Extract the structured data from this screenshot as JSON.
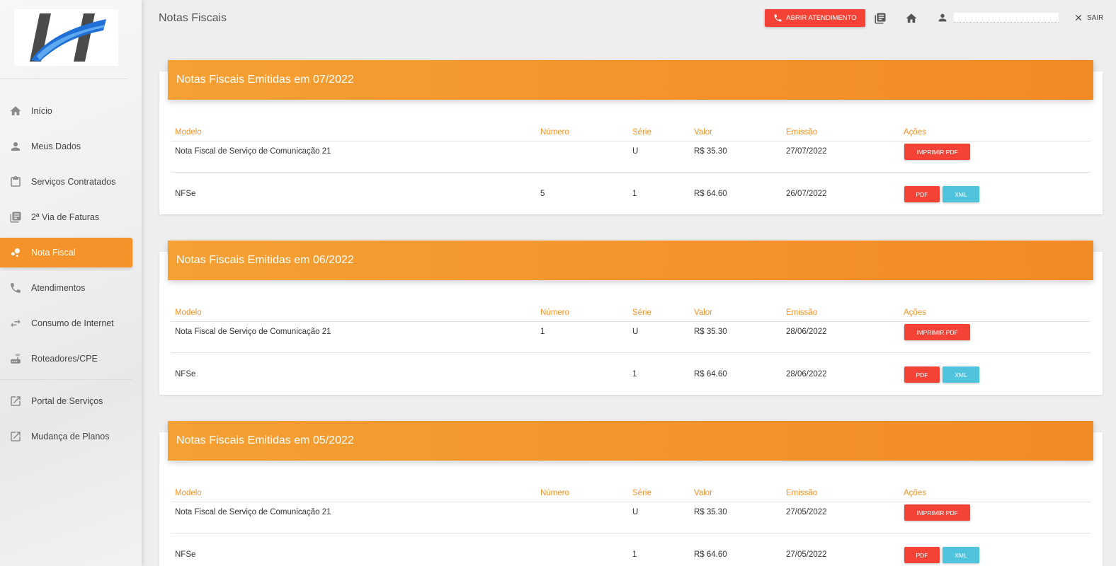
{
  "header": {
    "page_title": "Notas Fiscais",
    "attend_button": "ABRIR ATENDIMENTO",
    "logout": "SAIR"
  },
  "sidebar": {
    "items": [
      {
        "label": "Início",
        "icon": "home-icon"
      },
      {
        "label": "Meus Dados",
        "icon": "person-icon"
      },
      {
        "label": "Serviços Contratados",
        "icon": "clipboard-icon"
      },
      {
        "label": "2ª Via de Faturas",
        "icon": "library-books-icon"
      },
      {
        "label": "Nota Fiscal",
        "icon": "bubble-icon",
        "active": true
      },
      {
        "label": "Atendimentos",
        "icon": "phone-icon"
      },
      {
        "label": "Consumo de Internet",
        "icon": "swap-icon"
      },
      {
        "label": "Roteadores/CPE",
        "icon": "router-icon"
      },
      {
        "label": "Portal de Serviços",
        "icon": "external-link-icon"
      },
      {
        "label": "Mudança de Planos",
        "icon": "external-link-icon"
      }
    ]
  },
  "table_headers": {
    "modelo": "Modelo",
    "numero": "Número",
    "serie": "Série",
    "valor": "Valor",
    "emissao": "Emissão",
    "acoes": "Ações"
  },
  "buttons": {
    "imprimir": "IMPRIMIR PDF",
    "pdf": "PDF",
    "xml": "XML"
  },
  "cards": [
    {
      "title": "Notas Fiscais Emitidas em 07/2022",
      "rows": [
        {
          "modelo": "Nota Fiscal de Serviço de Comunicação 21",
          "numero": "",
          "serie": "U",
          "valor": "R$ 35.30",
          "emissao": "27/07/2022"
        },
        {
          "modelo": "NFSe",
          "numero": "5",
          "serie": "1",
          "valor": "R$ 64.60",
          "emissao": "26/07/2022"
        }
      ]
    },
    {
      "title": "Notas Fiscais Emitidas em 06/2022",
      "rows": [
        {
          "modelo": "Nota Fiscal de Serviço de Comunicação 21",
          "numero": "1",
          "serie": "U",
          "valor": "R$ 35.30",
          "emissao": "28/06/2022"
        },
        {
          "modelo": "NFSe",
          "numero": "",
          "serie": "1",
          "valor": "R$ 64.60",
          "emissao": "28/06/2022"
        }
      ]
    },
    {
      "title": "Notas Fiscais Emitidas em 05/2022",
      "rows": [
        {
          "modelo": "Nota Fiscal de Serviço de Comunicação 21",
          "numero": "",
          "serie": "U",
          "valor": "R$ 35.30",
          "emissao": "27/05/2022"
        },
        {
          "modelo": "NFSe",
          "numero": "",
          "serie": "1",
          "valor": "R$ 64.60",
          "emissao": "27/05/2022"
        }
      ]
    }
  ]
}
